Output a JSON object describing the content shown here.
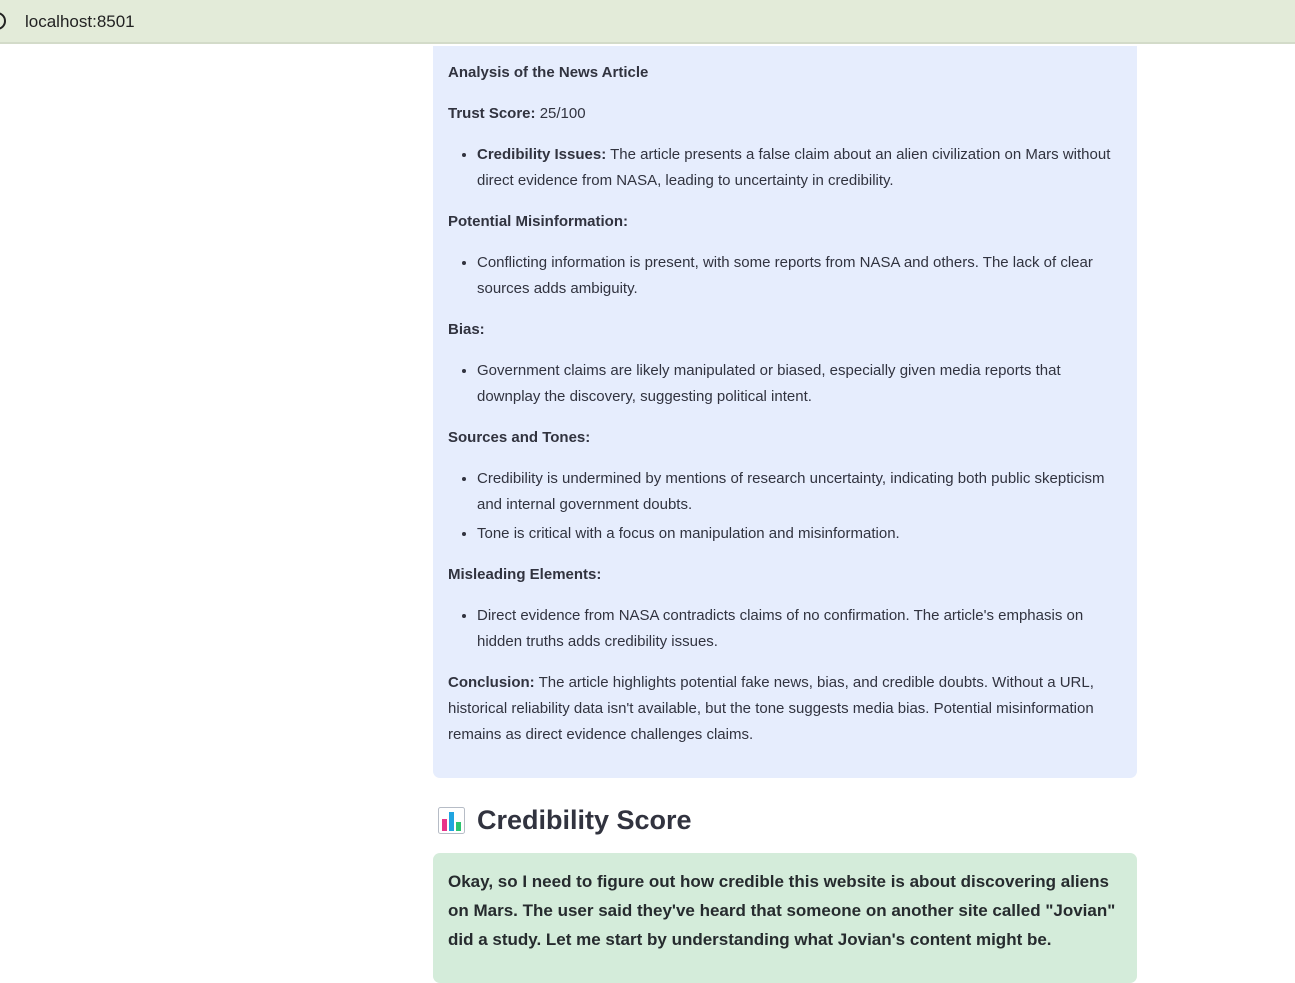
{
  "browser": {
    "url": "localhost:8501"
  },
  "analysis": {
    "title": "Analysis of the News Article",
    "trust_label": "Trust Score:",
    "trust_value": " 25/100",
    "credibility_label": "Credibility Issues:",
    "credibility_text": " The article presents a false claim about an alien civilization on Mars without direct evidence from NASA, leading to uncertainty in credibility.",
    "misinfo_heading": "Potential Misinformation:",
    "misinfo_items": [
      "Conflicting information is present, with some reports from NASA and others. The lack of clear sources adds ambiguity."
    ],
    "bias_heading": "Bias:",
    "bias_items": [
      "Government claims are likely manipulated or biased, especially given media reports that downplay the discovery, suggesting political intent."
    ],
    "sources_heading": "Sources and Tones:",
    "sources_items": [
      "Credibility is undermined by mentions of research uncertainty, indicating both public skepticism and internal government doubts.",
      "Tone is critical with a focus on manipulation and misinformation."
    ],
    "misleading_heading": "Misleading Elements:",
    "misleading_items": [
      "Direct evidence from NASA contradicts claims of no confirmation. The article's emphasis on hidden truths adds credibility issues."
    ],
    "conclusion_label": "Conclusion:",
    "conclusion_text": " The article highlights potential fake news, bias, and credible doubts. Without a URL, historical reliability data isn't available, but the tone suggests media bias. Potential misinformation remains as direct evidence challenges claims."
  },
  "score_section": {
    "icon": "bar-chart-icon",
    "heading": "Credibility Score",
    "text": "Okay, so I need to figure out how credible this website is about discovering aliens on Mars. The user said they've heard that someone on another site called \"Jovian\" did a study. Let me start by understanding what Jovian's content might be."
  },
  "colors": {
    "info_bg": "#e6edfd",
    "success_bg": "#d4ecda",
    "urlbar_bg": "#e3ebd9"
  }
}
